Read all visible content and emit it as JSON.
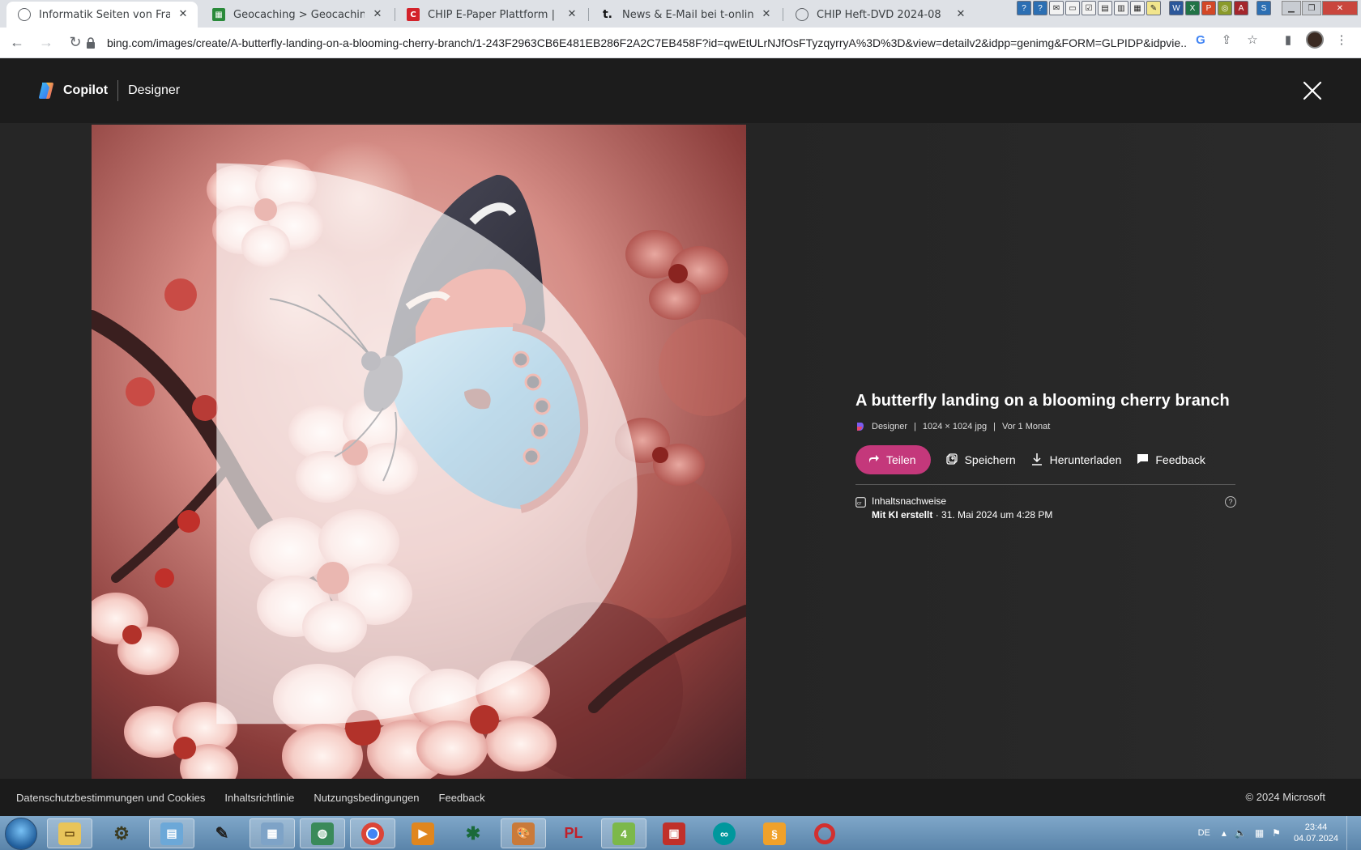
{
  "browser": {
    "tabs": [
      {
        "title": "Informatik Seiten von Frank Rost",
        "favicon": "globe-icon",
        "active": true
      },
      {
        "title": "Geocaching > Geocaching Maps",
        "favicon": "geocaching-icon",
        "active": false
      },
      {
        "title": "CHIP E-Paper Plattform | Meine H",
        "favicon": "chip-icon",
        "active": false
      },
      {
        "title": "News & E-Mail bei t-online.de | P",
        "favicon": "t-online-icon",
        "active": false
      },
      {
        "title": "CHIP Heft-DVD 2024-08",
        "favicon": "globe-icon",
        "active": false
      }
    ],
    "url": "bing.com/images/create/A-butterfly-landing-on-a-blooming-cherry-branch/1-243F2963CB6E481EB286F2A2C7EB458F?id=qwEtULrNJfOsFTyzqyrryA%3D%3D&view=detailv2&idpp=genimg&FORM=GLPIDP&idpvie..."
  },
  "app": {
    "brand": "Copilot",
    "section": "Designer"
  },
  "image": {
    "alt": "A butterfly landing on a blooming cherry branch",
    "title": "A butterfly landing on a blooming cherry branch",
    "meta": {
      "creator": "Designer",
      "dimensions": "1024 × 1024 jpg",
      "age": "Vor 1 Monat"
    },
    "actions": {
      "share": "Teilen",
      "save": "Speichern",
      "download": "Herunterladen",
      "feedback": "Feedback"
    },
    "credentials": {
      "label": "Inhaltsnachweise",
      "ai_label": "Mit KI erstellt",
      "created": " · 31. Mai 2024 um 4:28 PM"
    }
  },
  "footer": {
    "links": [
      "Datenschutzbestimmungen und Cookies",
      "Inhaltsrichtlinie",
      "Nutzungsbedingungen",
      "Feedback"
    ],
    "copyright": "© 2024 Microsoft"
  },
  "taskbar": {
    "language": "DE",
    "time": "23:44",
    "date": "04.07.2024",
    "apps": [
      "file-explorer",
      "settings-gear",
      "notepad",
      "pen-tool",
      "calculator",
      "globe-tool",
      "chrome",
      "media-player",
      "xara",
      "paint",
      "pl",
      "minecraft",
      "red-app",
      "arduino",
      "orange-app",
      "lifebuoy"
    ]
  },
  "colors": {
    "accent_pink": "#c4387b",
    "page_bg": "#242424",
    "topbar_bg": "#1c1c1c"
  }
}
